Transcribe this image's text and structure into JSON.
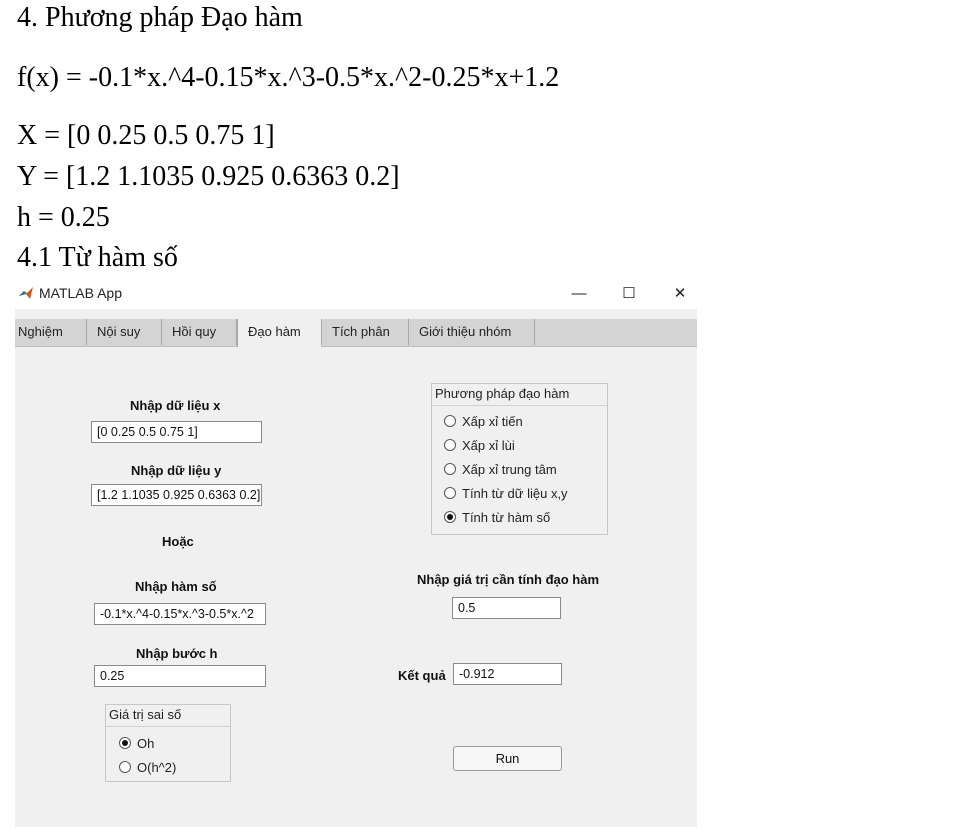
{
  "document": {
    "heading": "4.  Phương pháp Đạo hàm",
    "function_line": "f(x) = -0.1*x.^4-0.15*x.^3-0.5*x.^2-0.25*x+1.2",
    "x_line": "X = [0 0.25 0.5 0.75 1]",
    "y_line": "Y = [1.2 1.1035 0.925 0.6363 0.2]",
    "h_line": "h = 0.25",
    "subheading": "4.1 Từ hàm số"
  },
  "window": {
    "title": "MATLAB App",
    "minimize": "—",
    "maximize": "☐",
    "close": "✕"
  },
  "tabs": [
    {
      "label": "Nghiệm"
    },
    {
      "label": "Nội suy"
    },
    {
      "label": "Hồi quy"
    },
    {
      "label": "Đạo hàm",
      "active": true
    },
    {
      "label": "Tích phân"
    },
    {
      "label": "Giới thiệu nhóm"
    }
  ],
  "form": {
    "x_label": "Nhập dữ liệu x",
    "x_value": "[0 0.25 0.5 0.75 1]",
    "y_label": "Nhập dữ liệu y",
    "y_value": "[1.2 1.1035 0.925 0.6363 0.2]",
    "or_label": "Hoặc",
    "func_label": "Nhập hàm số",
    "func_value": "-0.1*x.^4-0.15*x.^3-0.5*x.^2",
    "step_label": "Nhập bước h",
    "step_value": "0.25",
    "point_label": "Nhập giá trị cần tính đạo hàm",
    "point_value": "0.5",
    "result_label": "Kết quả",
    "result_value": "-0.912",
    "run_label": "Run"
  },
  "method_group": {
    "title": "Phương pháp đạo hàm",
    "options": [
      {
        "label": "Xấp xỉ tiến",
        "selected": false
      },
      {
        "label": "Xấp xỉ lùi",
        "selected": false
      },
      {
        "label": "Xấp xỉ trung tâm",
        "selected": false
      },
      {
        "label": "Tính từ dữ liệu x,y",
        "selected": false
      },
      {
        "label": "Tính từ hàm số",
        "selected": true
      }
    ]
  },
  "error_group": {
    "title": "Giá trị sai số",
    "options": [
      {
        "label": "Oh",
        "selected": true
      },
      {
        "label": "O(h^2)",
        "selected": false
      }
    ]
  }
}
